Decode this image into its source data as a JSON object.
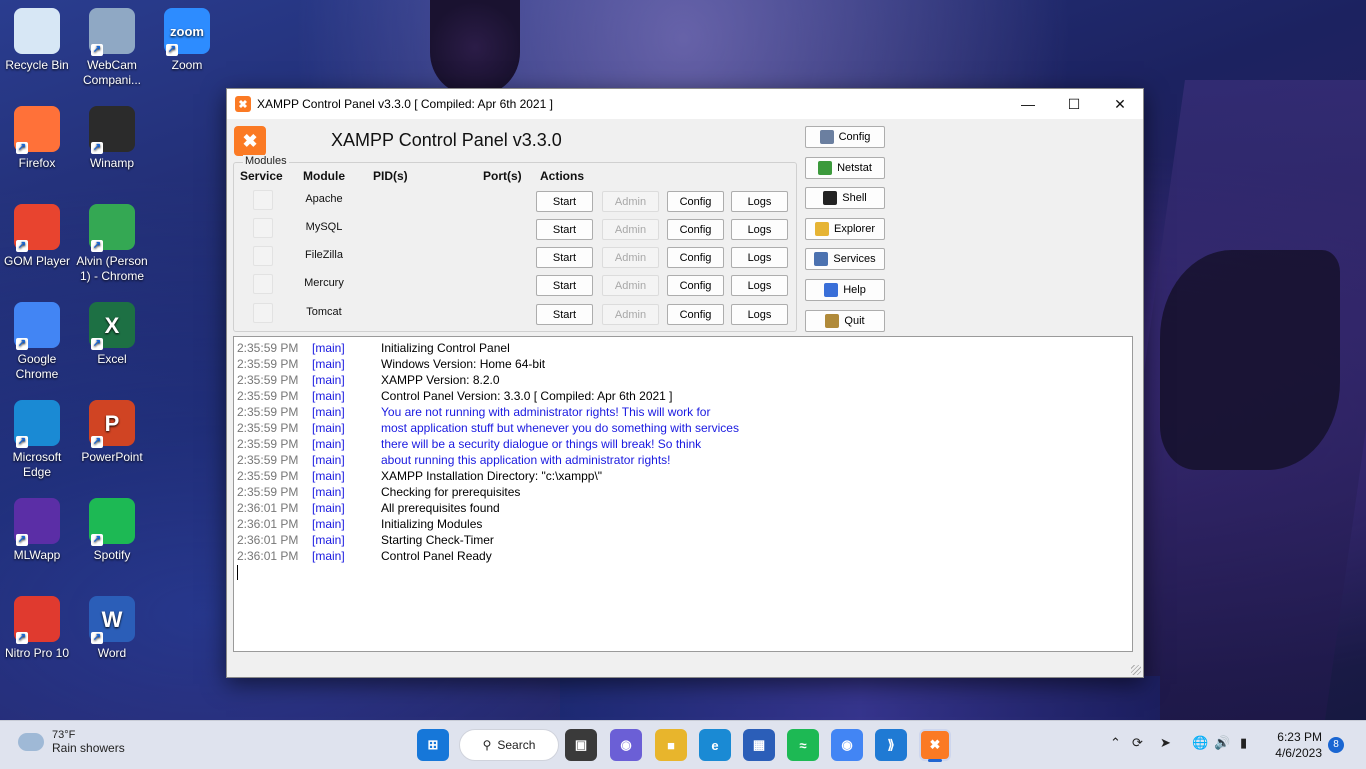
{
  "desktop": {
    "icons": [
      {
        "label": "Recycle Bin",
        "icon": "recycle-bin-icon",
        "color": "#d7e7f5"
      },
      {
        "label": "WebCam Compani...",
        "icon": "webcam-icon",
        "color": "#8fa8c4"
      },
      {
        "label": "Zoom",
        "icon": "zoom-icon",
        "color": "#2d8cff",
        "glyph": "zoom"
      },
      {
        "label": "Firefox",
        "icon": "firefox-icon",
        "color": "#ff7139"
      },
      {
        "label": "Winamp",
        "icon": "winamp-icon",
        "color": "#2b2b2b"
      },
      {
        "label": "GOM Player",
        "icon": "gom-player-icon",
        "color": "#e8442f"
      },
      {
        "label": "Alvin (Person 1) - Chrome",
        "icon": "chrome-profile-icon",
        "color": "#34a853"
      },
      {
        "label": "Google Chrome",
        "icon": "chrome-icon",
        "color": "#4285f4"
      },
      {
        "label": "Excel",
        "icon": "excel-icon",
        "color": "#1d7044",
        "glyph": "X"
      },
      {
        "label": "Microsoft Edge",
        "icon": "edge-icon",
        "color": "#1a8ad4"
      },
      {
        "label": "PowerPoint",
        "icon": "powerpoint-icon",
        "color": "#d04423",
        "glyph": "P"
      },
      {
        "label": "MLWapp",
        "icon": "mlwapp-icon",
        "color": "#5b2ea6"
      },
      {
        "label": "Spotify",
        "icon": "spotify-icon",
        "color": "#1db954"
      },
      {
        "label": "Nitro Pro 10",
        "icon": "nitro-icon",
        "color": "#e03a2f"
      },
      {
        "label": "Word",
        "icon": "word-icon",
        "color": "#2b5eb8",
        "glyph": "W"
      }
    ]
  },
  "window": {
    "title": "XAMPP Control Panel v3.3.0   [ Compiled: Apr 6th 2021 ]",
    "headline": "XAMPP Control Panel v3.3.0",
    "modules_label": "Modules",
    "headers": {
      "service": "Service",
      "module": "Module",
      "pids": "PID(s)",
      "ports": "Port(s)",
      "actions": "Actions"
    },
    "modules": [
      {
        "name": "Apache",
        "start": "Start",
        "admin": "Admin",
        "config": "Config",
        "logs": "Logs"
      },
      {
        "name": "MySQL",
        "start": "Start",
        "admin": "Admin",
        "config": "Config",
        "logs": "Logs"
      },
      {
        "name": "FileZilla",
        "start": "Start",
        "admin": "Admin",
        "config": "Config",
        "logs": "Logs"
      },
      {
        "name": "Mercury",
        "start": "Start",
        "admin": "Admin",
        "config": "Config",
        "logs": "Logs"
      },
      {
        "name": "Tomcat",
        "start": "Start",
        "admin": "Admin",
        "config": "Config",
        "logs": "Logs"
      }
    ],
    "side_buttons": [
      {
        "label": "Config",
        "icon": "wrench-icon"
      },
      {
        "label": "Netstat",
        "icon": "globe-icon"
      },
      {
        "label": "Shell",
        "icon": "terminal-icon"
      },
      {
        "label": "Explorer",
        "icon": "folder-icon"
      },
      {
        "label": "Services",
        "icon": "services-icon"
      },
      {
        "label": "Help",
        "icon": "help-icon"
      },
      {
        "label": "Quit",
        "icon": "door-icon"
      }
    ],
    "log": [
      {
        "time": "2:35:59 PM",
        "module": "[main]",
        "msg": "Initializing Control Panel",
        "warn": false
      },
      {
        "time": "2:35:59 PM",
        "module": "[main]",
        "msg": "Windows Version:  Home  64-bit",
        "warn": false
      },
      {
        "time": "2:35:59 PM",
        "module": "[main]",
        "msg": "XAMPP Version: 8.2.0",
        "warn": false
      },
      {
        "time": "2:35:59 PM",
        "module": "[main]",
        "msg": "Control Panel Version: 3.3.0  [ Compiled: Apr 6th 2021 ]",
        "warn": false
      },
      {
        "time": "2:35:59 PM",
        "module": "[main]",
        "msg": "You are not running with administrator rights! This will work for",
        "warn": true
      },
      {
        "time": "2:35:59 PM",
        "module": "[main]",
        "msg": "most application stuff but whenever you do something with services",
        "warn": true
      },
      {
        "time": "2:35:59 PM",
        "module": "[main]",
        "msg": "there will be a security dialogue or things will break! So think",
        "warn": true
      },
      {
        "time": "2:35:59 PM",
        "module": "[main]",
        "msg": "about running this application with administrator rights!",
        "warn": true
      },
      {
        "time": "2:35:59 PM",
        "module": "[main]",
        "msg": "XAMPP Installation Directory: \"c:\\xampp\\\"",
        "warn": false
      },
      {
        "time": "2:35:59 PM",
        "module": "[main]",
        "msg": "Checking for prerequisites",
        "warn": false
      },
      {
        "time": "2:36:01 PM",
        "module": "[main]",
        "msg": "All prerequisites found",
        "warn": false
      },
      {
        "time": "2:36:01 PM",
        "module": "[main]",
        "msg": "Initializing Modules",
        "warn": false
      },
      {
        "time": "2:36:01 PM",
        "module": "[main]",
        "msg": "Starting Check-Timer",
        "warn": false
      },
      {
        "time": "2:36:01 PM",
        "module": "[main]",
        "msg": "Control Panel Ready",
        "warn": false
      }
    ]
  },
  "taskbar": {
    "weather_temp": "73°F",
    "weather_desc": "Rain showers",
    "search_label": "Search",
    "time": "6:23 PM",
    "date": "4/6/2023",
    "notification_count": "8"
  }
}
